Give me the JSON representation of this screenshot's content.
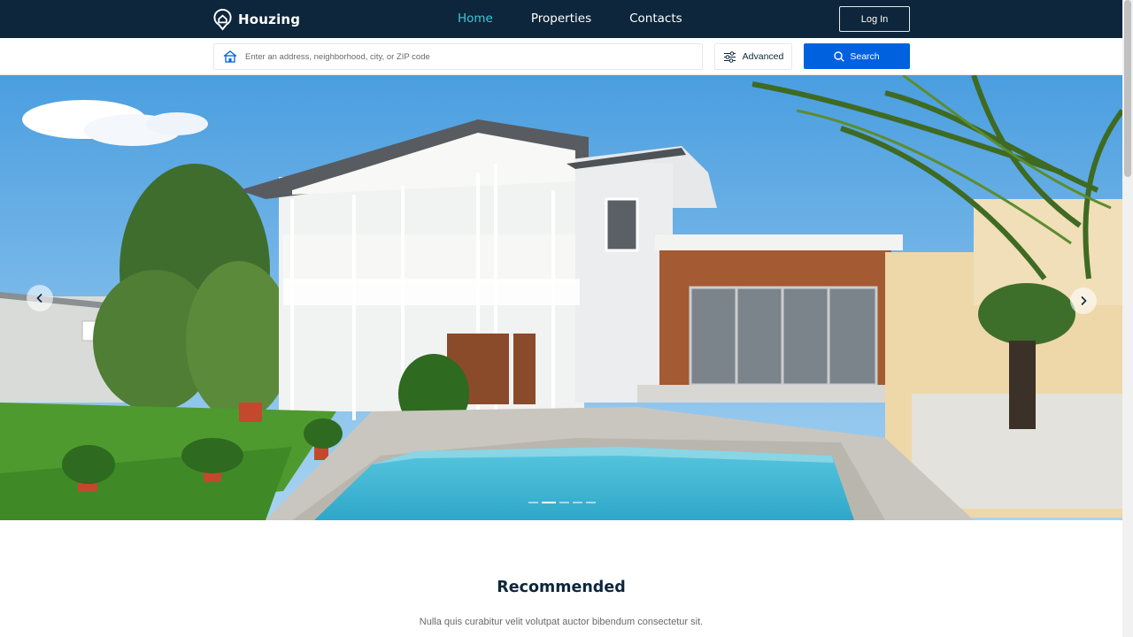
{
  "navbar": {
    "brand": "Houzing",
    "links": [
      {
        "label": "Home",
        "active": true
      },
      {
        "label": "Properties",
        "active": false
      },
      {
        "label": "Contacts",
        "active": false
      }
    ],
    "login_label": "Log In"
  },
  "search": {
    "placeholder": "Enter an address, neighborhood, city, or ZIP code",
    "advanced_label": "Advanced",
    "search_label": "Search"
  },
  "hero": {
    "image_alt": "white colonial house with pool",
    "active_slide": 2,
    "slide_count": 5
  },
  "recommended": {
    "title": "Recommended",
    "subtitle": "Nulla quis curabitur velit volutpat auctor bibendum consectetur sit."
  },
  "colors": {
    "navbar_bg": "#0d263b",
    "accent": "#3fc6da",
    "primary": "#0061df"
  },
  "icons": {
    "brand": "map-pin-house-icon",
    "search_field": "house-icon",
    "advanced": "sliders-icon",
    "search": "search-icon",
    "prev": "chevron-left-icon",
    "next": "chevron-right-icon"
  }
}
